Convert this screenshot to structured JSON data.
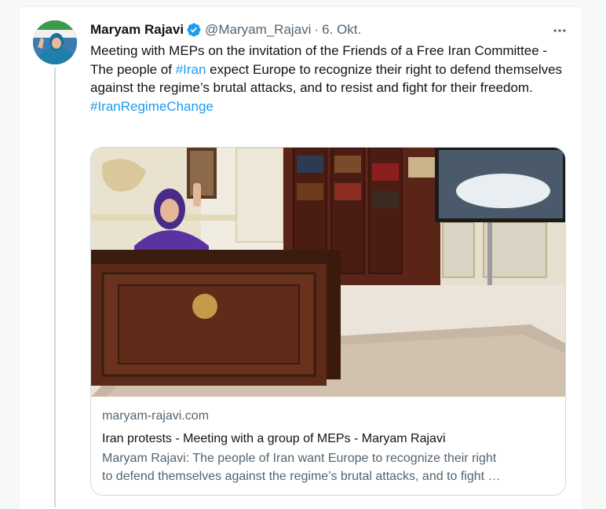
{
  "tweet": {
    "author": {
      "display_name": "Maryam Rajavi",
      "handle": "@Maryam_Rajavi",
      "verified_icon": "verified-badge-icon"
    },
    "separator": "·",
    "date": "6. Okt.",
    "more_icon": "more-horizontal-icon",
    "text": {
      "part1": "Meeting with MEPs on the invitation of the Friends of a Free Iran Committee -The people of ",
      "hashtag_iran": "#Iran",
      "part2": " expect Europe to recognize their right to defend themselves against the regime’s brutal attacks, and to resist and fight for their freedom.",
      "hashtag_change": "#IranRegimeChange"
    },
    "card": {
      "domain": "maryam-rajavi.com",
      "title": "Iran protests - Meeting with a group of MEPs - Maryam Rajavi",
      "description_line1": "Maryam Rajavi: The people of Iran want Europe to recognize their right",
      "description_line2": "to defend themselves against the regime’s brutal attacks, and to fight …"
    }
  },
  "colors": {
    "link": "#1d9bf0",
    "secondary_text": "#536471",
    "primary_text": "#0f1419",
    "verified": "#1d9bf0"
  }
}
